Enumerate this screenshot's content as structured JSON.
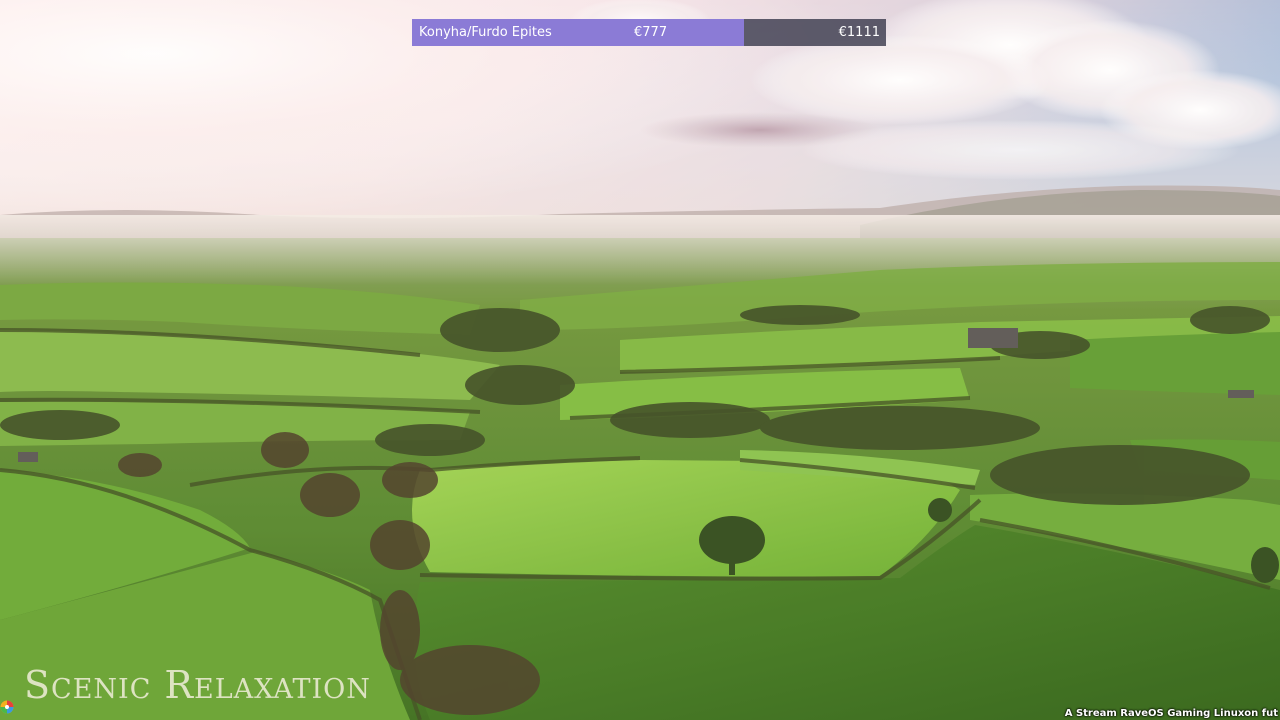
{
  "goal": {
    "name": "Konyha/Furdo Epites",
    "current": "€777",
    "target": "€1111",
    "progress_fraction": 0.7,
    "fill_color": "#8b7bd6"
  },
  "watermark": {
    "text": "Scenic Relaxation"
  },
  "corner_logo": {
    "icon": "rainbow-swirl-logo-icon"
  },
  "ticker": {
    "text": "A Stream RaveOS Gaming Linuxon fut"
  }
}
